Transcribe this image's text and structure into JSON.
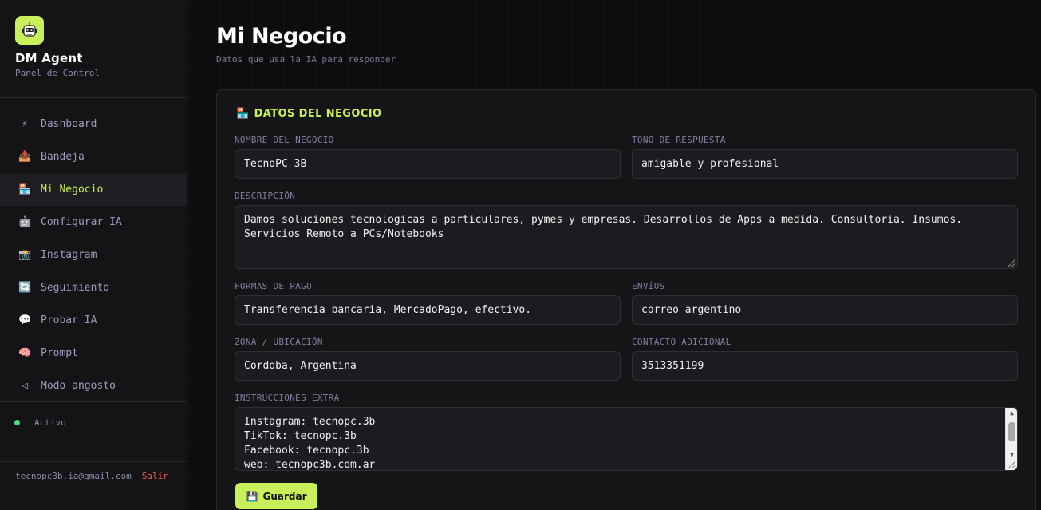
{
  "brand": {
    "title": "DM Agent",
    "subtitle": "Panel de Control",
    "logo_icon": "robot-icon"
  },
  "nav": [
    {
      "label": "Dashboard",
      "icon": "⚡",
      "name": "dashboard",
      "active": false
    },
    {
      "label": "Bandeja",
      "icon": "📥",
      "name": "bandeja",
      "active": false
    },
    {
      "label": "Mi Negocio",
      "icon": "🏪",
      "name": "mi-negocio",
      "active": true
    },
    {
      "label": "Configurar IA",
      "icon": "🤖",
      "name": "configurar-ia",
      "active": false
    },
    {
      "label": "Instagram",
      "icon": "📸",
      "name": "instagram",
      "active": false
    },
    {
      "label": "Seguimiento",
      "icon": "🔄",
      "name": "seguimiento",
      "active": false
    },
    {
      "label": "Probar IA",
      "icon": "💬",
      "name": "probar-ia",
      "active": false
    },
    {
      "label": "Prompt",
      "icon": "🧠",
      "name": "prompt",
      "active": false
    },
    {
      "label": "Modo angosto",
      "icon": "◁",
      "name": "modo-angosto",
      "active": false
    }
  ],
  "status": {
    "label": "Activo",
    "color": "#4ade80"
  },
  "footer": {
    "email": "tecnopc3b.ia@gmail.com",
    "logout": "Salir"
  },
  "page": {
    "title": "Mi Negocio",
    "subtitle": "Datos que usa la IA para responder"
  },
  "section": {
    "title": "DATOS DEL NEGOCIO",
    "icon": "🏪"
  },
  "form": {
    "nombre": {
      "label": "NOMBRE DEL NEGOCIO",
      "value": "TecnoPC 3B"
    },
    "tono": {
      "label": "TONO DE RESPUESTA",
      "value": "amigable y profesional"
    },
    "descripcion": {
      "label": "DESCRIPCIÓN",
      "lines": [
        "Damos soluciones tecnologicas a particulares, pymes y empresas. Desarrollos de Apps a medida. Consultoria. Insumos.",
        "Servicios Remoto a PCs/Notebooks"
      ]
    },
    "pago": {
      "label": "FORMAS DE PAGO",
      "value": "Transferencia bancaria, MercadoPago, efectivo."
    },
    "envios": {
      "label": "ENVÍOS",
      "value": "correo argentino"
    },
    "zona": {
      "label": "ZONA / UBICACIÓN",
      "value": "Cordoba, Argentina"
    },
    "contacto": {
      "label": "CONTACTO ADICIONAL",
      "value": "3513351199"
    },
    "instrucciones": {
      "label": "INSTRUCCIONES EXTRA",
      "lines": [
        "Instagram: tecnopc.3b",
        "TikTok: tecnopc.3b",
        "Facebook: tecnopc.3b",
        "web: tecnopc3b.com.ar"
      ]
    }
  },
  "save_button": {
    "label": "Guardar",
    "icon": "💾"
  },
  "colors": {
    "accent": "#c9f05a",
    "danger": "#f05a5a",
    "background": "#0d0d10"
  }
}
